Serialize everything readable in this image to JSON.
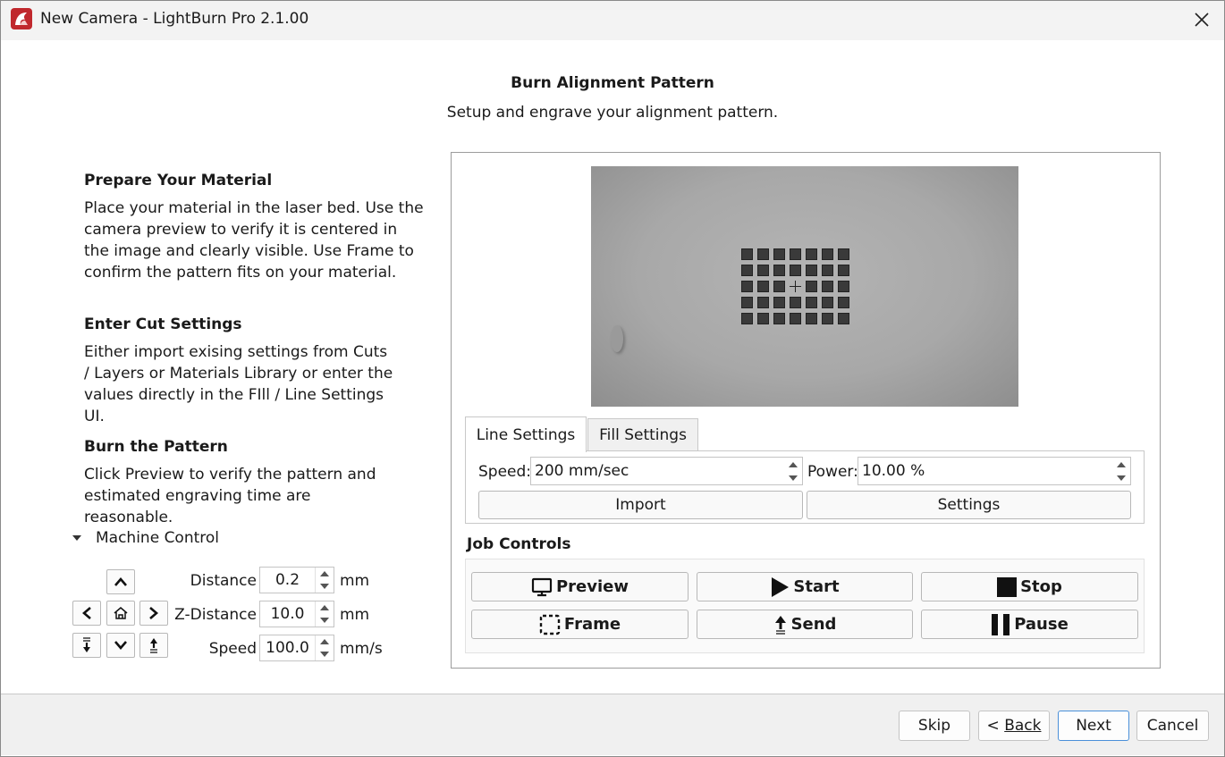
{
  "window": {
    "title": "New Camera - LightBurn Pro 2.1.00"
  },
  "header": {
    "title": "Burn Alignment Pattern",
    "subtitle": "Setup and engrave your alignment pattern."
  },
  "steps": [
    {
      "title": "Prepare Your Material",
      "body": "Place your material in the laser bed. Use the camera preview to verify it is centered in the image and clearly visible. Use Frame to confirm the pattern fits on your material."
    },
    {
      "title": "Enter Cut Settings",
      "body": "Either import exising settings from Cuts / Layers or Materials Library or enter the values directly in the FIll / Line Settings UI."
    },
    {
      "title": "Burn the Pattern",
      "body": "Click Preview to verify the pattern and estimated engraving time are reasonable."
    }
  ],
  "machine_control": {
    "label": "Machine Control",
    "distance": {
      "label": "Distance",
      "value": "0.2",
      "unit": "mm"
    },
    "z_distance": {
      "label": "Z-Distance",
      "value": "10.0",
      "unit": "mm"
    },
    "speed": {
      "label": "Speed",
      "value": "100.0",
      "unit": "mm/s"
    },
    "jog_icons": [
      "arrow-up-icon",
      "arrow-left-icon",
      "home-icon",
      "arrow-right-icon",
      "z-down-icon",
      "arrow-down-icon",
      "z-up-icon"
    ]
  },
  "settings": {
    "tabs": [
      "Line Settings",
      "Fill Settings"
    ],
    "active_tab": "Line Settings",
    "speed": {
      "label": "Speed:",
      "value": "200 mm/sec"
    },
    "power": {
      "label": "Power:",
      "value": "10.00 %"
    },
    "import_label": "Import",
    "settings_label": "Settings"
  },
  "job_controls": {
    "title": "Job Controls",
    "preview": "Preview",
    "start": "Start",
    "stop": "Stop",
    "frame": "Frame",
    "send": "Send",
    "pause": "Pause"
  },
  "footer": {
    "skip": "Skip",
    "back_prefix": "< ",
    "back": "Back",
    "next": "Next",
    "cancel": "Cancel"
  },
  "colors": {
    "app_icon": "#c0282d",
    "title_bar": "#f3f3f3",
    "footer": "#f0f0f0",
    "default_button_border": "#4a90d9"
  }
}
